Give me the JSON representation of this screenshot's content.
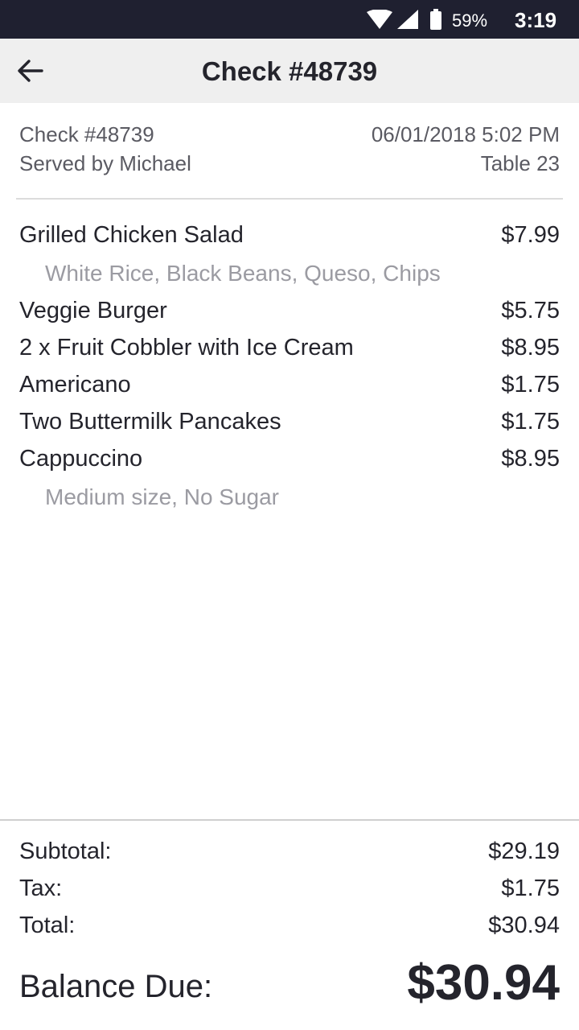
{
  "status_bar": {
    "battery": "59%",
    "time": "3:19"
  },
  "header": {
    "title": "Check #48739"
  },
  "check": {
    "number": "Check #48739",
    "server": "Served by Michael",
    "datetime": "06/01/2018 5:02 PM",
    "table": "Table 23"
  },
  "items": [
    {
      "name": "Grilled Chicken Salad",
      "price": "$7.99",
      "modifiers": "White Rice, Black Beans, Queso, Chips"
    },
    {
      "name": "Veggie Burger",
      "price": "$5.75",
      "modifiers": ""
    },
    {
      "name": "2 x Fruit Cobbler with Ice Cream",
      "price": "$8.95",
      "modifiers": ""
    },
    {
      "name": "Americano",
      "price": "$1.75",
      "modifiers": ""
    },
    {
      "name": "Two Buttermilk Pancakes",
      "price": "$1.75",
      "modifiers": ""
    },
    {
      "name": "Cappuccino",
      "price": "$8.95",
      "modifiers": "Medium size, No Sugar"
    }
  ],
  "totals": {
    "subtotal_label": "Subtotal:",
    "subtotal": "$29.19",
    "tax_label": "Tax:",
    "tax": "$1.75",
    "total_label": "Total:",
    "total": "$30.94",
    "balance_label": "Balance Due:",
    "balance": "$30.94"
  },
  "icons": {
    "back": "arrow-left-icon",
    "wifi": "wifi-icon",
    "signal": "cell-signal-icon",
    "battery": "battery-icon"
  },
  "colors": {
    "status_bar": "#1f2030",
    "app_bar": "#efefef",
    "text": "#24242c",
    "muted": "#9b9ba2"
  }
}
